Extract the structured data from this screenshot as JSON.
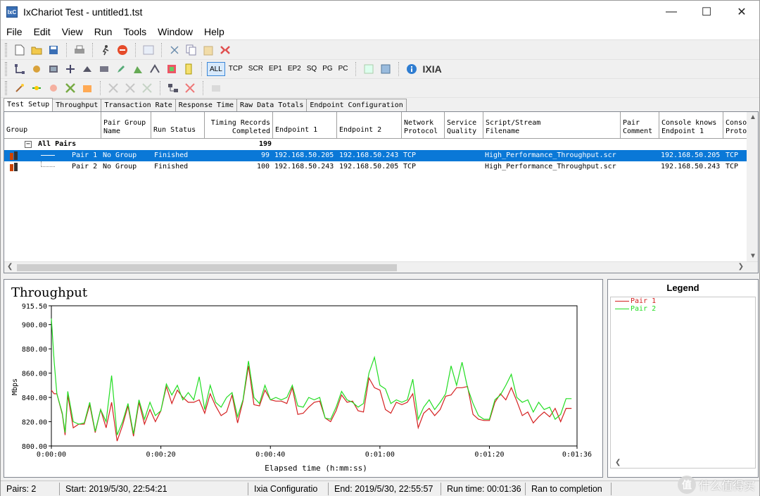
{
  "window": {
    "title": "IxChariot Test - untitled1.tst",
    "app_icon_label": "IxC"
  },
  "menu": [
    "File",
    "Edit",
    "View",
    "Run",
    "Tools",
    "Window",
    "Help"
  ],
  "toolbar3": {
    "filters": [
      "ALL",
      "TCP",
      "SCR",
      "EP1",
      "EP2",
      "SQ",
      "PG",
      "PC"
    ],
    "logo": "IXIA"
  },
  "tabs": [
    "Test Setup",
    "Throughput",
    "Transaction Rate",
    "Response Time",
    "Raw Data Totals",
    "Endpoint Configuration"
  ],
  "grid": {
    "headers": [
      "Group",
      "Pair Group\nName",
      "Run Status",
      "Timing Records\nCompleted",
      "Endpoint 1",
      "Endpoint 2",
      "Network\nProtocol",
      "Service\nQuality",
      "Script/Stream\nFilename",
      "Pair\nComment",
      "Console knows\nEndpoint 1",
      "Conso\nProto"
    ],
    "group_row": {
      "label": "All Pairs",
      "records": "199"
    },
    "rows": [
      {
        "pair": "Pair 1",
        "group": "No Group",
        "status": "Finished",
        "records": "99",
        "ep1": "192.168.50.205",
        "ep2": "192.168.50.243",
        "protocol": "TCP",
        "script": "High_Performance_Throughput.scr",
        "console_ep1": "192.168.50.205",
        "console_proto": "TCP"
      },
      {
        "pair": "Pair 2",
        "group": "No Group",
        "status": "Finished",
        "records": "100",
        "ep1": "192.168.50.243",
        "ep2": "192.168.50.205",
        "protocol": "TCP",
        "script": "High_Performance_Throughput.scr",
        "console_ep1": "192.168.50.243",
        "console_proto": "TCP"
      }
    ]
  },
  "legend": {
    "title": "Legend"
  },
  "chart_data": {
    "type": "line",
    "title": "Throughput",
    "xlabel": "Elapsed time (h:mm:ss)",
    "ylabel": "Mbps",
    "ylim": [
      800,
      915.5
    ],
    "xlim": [
      0,
      96
    ],
    "yticks": [
      "915.50",
      "900.00",
      "880.00",
      "860.00",
      "840.00",
      "820.00",
      "800.00"
    ],
    "ytick_values": [
      915.5,
      900,
      880,
      860,
      840,
      820,
      800
    ],
    "xticks": [
      "0:00:00",
      "0:00:20",
      "0:00:40",
      "0:01:00",
      "0:01:20",
      "0:01:36"
    ],
    "xtick_values": [
      0,
      20,
      40,
      60,
      80,
      96
    ],
    "series": [
      {
        "name": "Pair 1",
        "color": "#d42020",
        "values": [
          [
            0,
            846
          ],
          [
            0.5,
            843
          ],
          [
            1,
            843
          ],
          [
            2,
            826
          ],
          [
            2.5,
            809
          ],
          [
            3,
            842
          ],
          [
            4,
            815
          ],
          [
            5,
            818
          ],
          [
            6,
            818
          ],
          [
            7,
            834
          ],
          [
            8,
            811
          ],
          [
            9,
            830
          ],
          [
            10,
            815
          ],
          [
            11,
            836
          ],
          [
            12,
            804
          ],
          [
            13,
            817
          ],
          [
            14,
            833
          ],
          [
            15,
            808
          ],
          [
            16,
            836
          ],
          [
            17,
            818
          ],
          [
            18,
            830
          ],
          [
            19,
            820
          ],
          [
            20,
            829
          ],
          [
            21,
            849
          ],
          [
            22,
            835
          ],
          [
            23,
            846
          ],
          [
            24,
            840
          ],
          [
            25,
            836
          ],
          [
            26,
            836
          ],
          [
            27,
            838
          ],
          [
            28,
            827
          ],
          [
            29,
            843
          ],
          [
            30,
            833
          ],
          [
            31,
            825
          ],
          [
            32,
            828
          ],
          [
            33,
            842
          ],
          [
            34,
            819
          ],
          [
            35,
            837
          ],
          [
            36,
            866
          ],
          [
            37,
            834
          ],
          [
            38,
            833
          ],
          [
            39,
            846
          ],
          [
            40,
            838
          ],
          [
            41,
            837
          ],
          [
            42,
            837
          ],
          [
            43,
            835
          ],
          [
            44,
            848
          ],
          [
            45,
            826
          ],
          [
            46,
            827
          ],
          [
            47,
            832
          ],
          [
            48,
            836
          ],
          [
            49,
            837
          ],
          [
            50,
            823
          ],
          [
            51,
            820
          ],
          [
            52,
            829
          ],
          [
            53,
            842
          ],
          [
            54,
            836
          ],
          [
            55,
            837
          ],
          [
            56,
            829
          ],
          [
            57,
            828
          ],
          [
            58,
            856
          ],
          [
            59,
            848
          ],
          [
            60,
            846
          ],
          [
            61,
            830
          ],
          [
            62,
            827
          ],
          [
            63,
            836
          ],
          [
            64,
            834
          ],
          [
            65,
            836
          ],
          [
            66,
            843
          ],
          [
            67,
            815
          ],
          [
            68,
            827
          ],
          [
            69,
            831
          ],
          [
            70,
            825
          ],
          [
            71,
            830
          ],
          [
            72,
            841
          ],
          [
            73,
            842
          ],
          [
            74,
            848
          ],
          [
            75,
            848
          ],
          [
            76,
            849
          ],
          [
            77,
            826
          ],
          [
            78,
            822
          ],
          [
            79,
            821
          ],
          [
            80,
            821
          ],
          [
            81,
            836
          ],
          [
            82,
            843
          ],
          [
            83,
            838
          ],
          [
            84,
            848
          ],
          [
            85,
            837
          ],
          [
            86,
            825
          ],
          [
            87,
            828
          ],
          [
            88,
            819
          ],
          [
            89,
            824
          ],
          [
            90,
            828
          ],
          [
            91,
            824
          ],
          [
            92,
            831
          ],
          [
            93,
            820
          ],
          [
            94,
            831
          ],
          [
            95,
            831
          ]
        ]
      },
      {
        "name": "Pair 2",
        "color": "#22dd22",
        "values": [
          [
            0,
            905
          ],
          [
            0.5,
            870
          ],
          [
            1,
            843
          ],
          [
            2,
            827
          ],
          [
            2.5,
            811
          ],
          [
            3,
            845
          ],
          [
            4,
            820
          ],
          [
            5,
            818
          ],
          [
            6,
            819
          ],
          [
            7,
            836
          ],
          [
            8,
            812
          ],
          [
            9,
            830
          ],
          [
            10,
            820
          ],
          [
            11,
            858
          ],
          [
            12,
            809
          ],
          [
            13,
            820
          ],
          [
            14,
            835
          ],
          [
            15,
            810
          ],
          [
            16,
            838
          ],
          [
            17,
            822
          ],
          [
            18,
            836
          ],
          [
            19,
            825
          ],
          [
            20,
            829
          ],
          [
            21,
            851
          ],
          [
            22,
            842
          ],
          [
            23,
            850
          ],
          [
            24,
            838
          ],
          [
            25,
            844
          ],
          [
            26,
            838
          ],
          [
            27,
            857
          ],
          [
            28,
            830
          ],
          [
            29,
            850
          ],
          [
            30,
            836
          ],
          [
            31,
            832
          ],
          [
            32,
            840
          ],
          [
            33,
            844
          ],
          [
            34,
            824
          ],
          [
            35,
            838
          ],
          [
            36,
            870
          ],
          [
            37,
            840
          ],
          [
            38,
            835
          ],
          [
            39,
            850
          ],
          [
            40,
            838
          ],
          [
            41,
            840
          ],
          [
            42,
            838
          ],
          [
            43,
            840
          ],
          [
            44,
            850
          ],
          [
            45,
            833
          ],
          [
            46,
            832
          ],
          [
            47,
            840
          ],
          [
            48,
            838
          ],
          [
            49,
            840
          ],
          [
            50,
            823
          ],
          [
            51,
            822
          ],
          [
            52,
            832
          ],
          [
            53,
            845
          ],
          [
            54,
            838
          ],
          [
            55,
            836
          ],
          [
            56,
            832
          ],
          [
            57,
            835
          ],
          [
            58,
            860
          ],
          [
            59,
            873
          ],
          [
            60,
            850
          ],
          [
            61,
            847
          ],
          [
            62,
            835
          ],
          [
            63,
            838
          ],
          [
            64,
            836
          ],
          [
            65,
            838
          ],
          [
            66,
            855
          ],
          [
            67,
            822
          ],
          [
            68,
            832
          ],
          [
            69,
            838
          ],
          [
            70,
            830
          ],
          [
            71,
            836
          ],
          [
            72,
            843
          ],
          [
            73,
            866
          ],
          [
            74,
            850
          ],
          [
            75,
            869
          ],
          [
            76,
            848
          ],
          [
            77,
            835
          ],
          [
            78,
            825
          ],
          [
            79,
            822
          ],
          [
            80,
            822
          ],
          [
            81,
            838
          ],
          [
            82,
            842
          ],
          [
            83,
            850
          ],
          [
            84,
            859
          ],
          [
            85,
            840
          ],
          [
            86,
            836
          ],
          [
            87,
            838
          ],
          [
            88,
            828
          ],
          [
            89,
            836
          ],
          [
            90,
            830
          ],
          [
            91,
            832
          ],
          [
            92,
            822
          ],
          [
            93,
            826
          ],
          [
            94,
            839
          ],
          [
            95,
            839
          ]
        ]
      }
    ],
    "grid": false,
    "legend_position": "separate pane right"
  },
  "status": {
    "pairs": "Pairs: 2",
    "start": "Start: 2019/5/30, 22:54:21",
    "config": "Ixia Configuratio",
    "end": "End: 2019/5/30, 22:55:57",
    "run_time": "Run time: 00:01:36",
    "result": "Ran to completion",
    "watermark": "什么值得买",
    "watermark_mark": "值"
  }
}
